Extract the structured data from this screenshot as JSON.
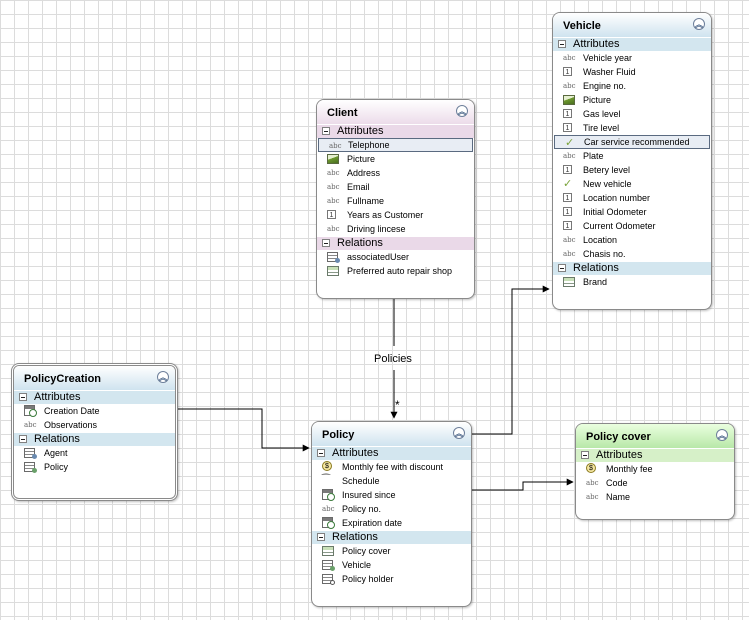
{
  "colors": {
    "blue_header": "#cfe3ef",
    "pink_header": "#ecdcea",
    "green_header": "#b8e8a8",
    "blue_section": "#d3e6ef",
    "pink_section": "#ead9e8",
    "green_section": "#d6f0c8",
    "connector": "#000000"
  },
  "connectors": [
    {
      "id": "client-policy",
      "label": "Policies",
      "multiplicity": "*"
    },
    {
      "id": "policycreation-policy"
    },
    {
      "id": "policy-vehicle"
    },
    {
      "id": "policy-policycover"
    }
  ],
  "entities": {
    "vehicle": {
      "title": "Vehicle",
      "attributes_label": "Attributes",
      "relations_label": "Relations",
      "attributes": [
        {
          "label": "Vehicle year",
          "icon": "abc"
        },
        {
          "label": "Washer Fluid",
          "icon": "number"
        },
        {
          "label": "Engine no.",
          "icon": "abc"
        },
        {
          "label": "Picture",
          "icon": "picture"
        },
        {
          "label": "Gas level",
          "icon": "number"
        },
        {
          "label": "Tire level",
          "icon": "number"
        },
        {
          "label": "Car service recommended",
          "icon": "check"
        },
        {
          "label": "Plate",
          "icon": "abc"
        },
        {
          "label": "Betery level",
          "icon": "number"
        },
        {
          "label": "New vehicle",
          "icon": "check"
        },
        {
          "label": "Location number",
          "icon": "number"
        },
        {
          "label": "Initial Odometer",
          "icon": "number"
        },
        {
          "label": "Current Odometer",
          "icon": "number"
        },
        {
          "label": "Location",
          "icon": "abc"
        },
        {
          "label": "Chasis no.",
          "icon": "abc"
        }
      ],
      "relations": [
        {
          "label": "Brand",
          "icon": "table"
        }
      ]
    },
    "client": {
      "title": "Client",
      "attributes_label": "Attributes",
      "relations_label": "Relations",
      "attributes": [
        {
          "label": "Telephone",
          "icon": "abc"
        },
        {
          "label": "Picture",
          "icon": "picture"
        },
        {
          "label": "Address",
          "icon": "abc"
        },
        {
          "label": "Email",
          "icon": "abc"
        },
        {
          "label": "Fullname",
          "icon": "abc"
        },
        {
          "label": "Years as Customer",
          "icon": "number"
        },
        {
          "label": "Driving lincese",
          "icon": "abc"
        }
      ],
      "relations": [
        {
          "label": "associatedUser",
          "icon": "user-list"
        },
        {
          "label": "Preferred auto repair shop",
          "icon": "table"
        }
      ]
    },
    "policycreation": {
      "title": "PolicyCreation",
      "attributes_label": "Attributes",
      "relations_label": "Relations",
      "attributes": [
        {
          "label": "Creation Date",
          "icon": "calendar"
        },
        {
          "label": "Observations",
          "icon": "abc"
        }
      ],
      "relations": [
        {
          "label": "Agent",
          "icon": "user-list"
        },
        {
          "label": "Policy",
          "icon": "user-list-green"
        }
      ]
    },
    "policy": {
      "title": "Policy",
      "attributes_label": "Attributes",
      "relations_label": "Relations",
      "attributes": [
        {
          "label": "Monthly fee with discount",
          "icon": "dollar"
        },
        {
          "label": "Schedule",
          "icon": "paperclip"
        },
        {
          "label": "Insured since",
          "icon": "calendar"
        },
        {
          "label": "Policy no.",
          "icon": "abc"
        },
        {
          "label": "Expiration date",
          "icon": "calendar"
        }
      ],
      "relations": [
        {
          "label": "Policy cover",
          "icon": "table"
        },
        {
          "label": "Vehicle",
          "icon": "user-list-green"
        },
        {
          "label": "Policy holder",
          "icon": "user-list-circle"
        }
      ]
    },
    "policycover": {
      "title": "Policy cover",
      "attributes_label": "Attributes",
      "attributes": [
        {
          "label": "Monthly fee",
          "icon": "dollar"
        },
        {
          "label": "Code",
          "icon": "abc"
        },
        {
          "label": "Name",
          "icon": "abc"
        }
      ]
    }
  }
}
